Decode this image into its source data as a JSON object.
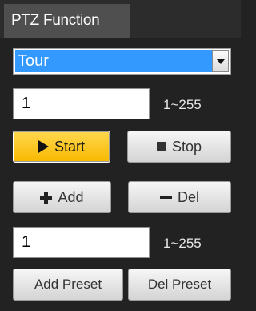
{
  "tab": {
    "title": "PTZ Function"
  },
  "function_select": {
    "selected": "Tour"
  },
  "tour_number": {
    "value": "1",
    "range": "1~255"
  },
  "buttons": {
    "start": "Start",
    "stop": "Stop",
    "add": "Add",
    "del": "Del",
    "add_preset": "Add Preset",
    "del_preset": "Del Preset"
  },
  "preset_number": {
    "value": "1",
    "range": "1~255"
  },
  "icons": {
    "start": "play-icon",
    "stop": "stop-icon",
    "add": "plus-icon",
    "del": "minus-icon",
    "dropdown": "chevron-down-icon"
  },
  "colors": {
    "accent": "#3399ff",
    "start_button": "#f8b800",
    "background": "#222222"
  }
}
